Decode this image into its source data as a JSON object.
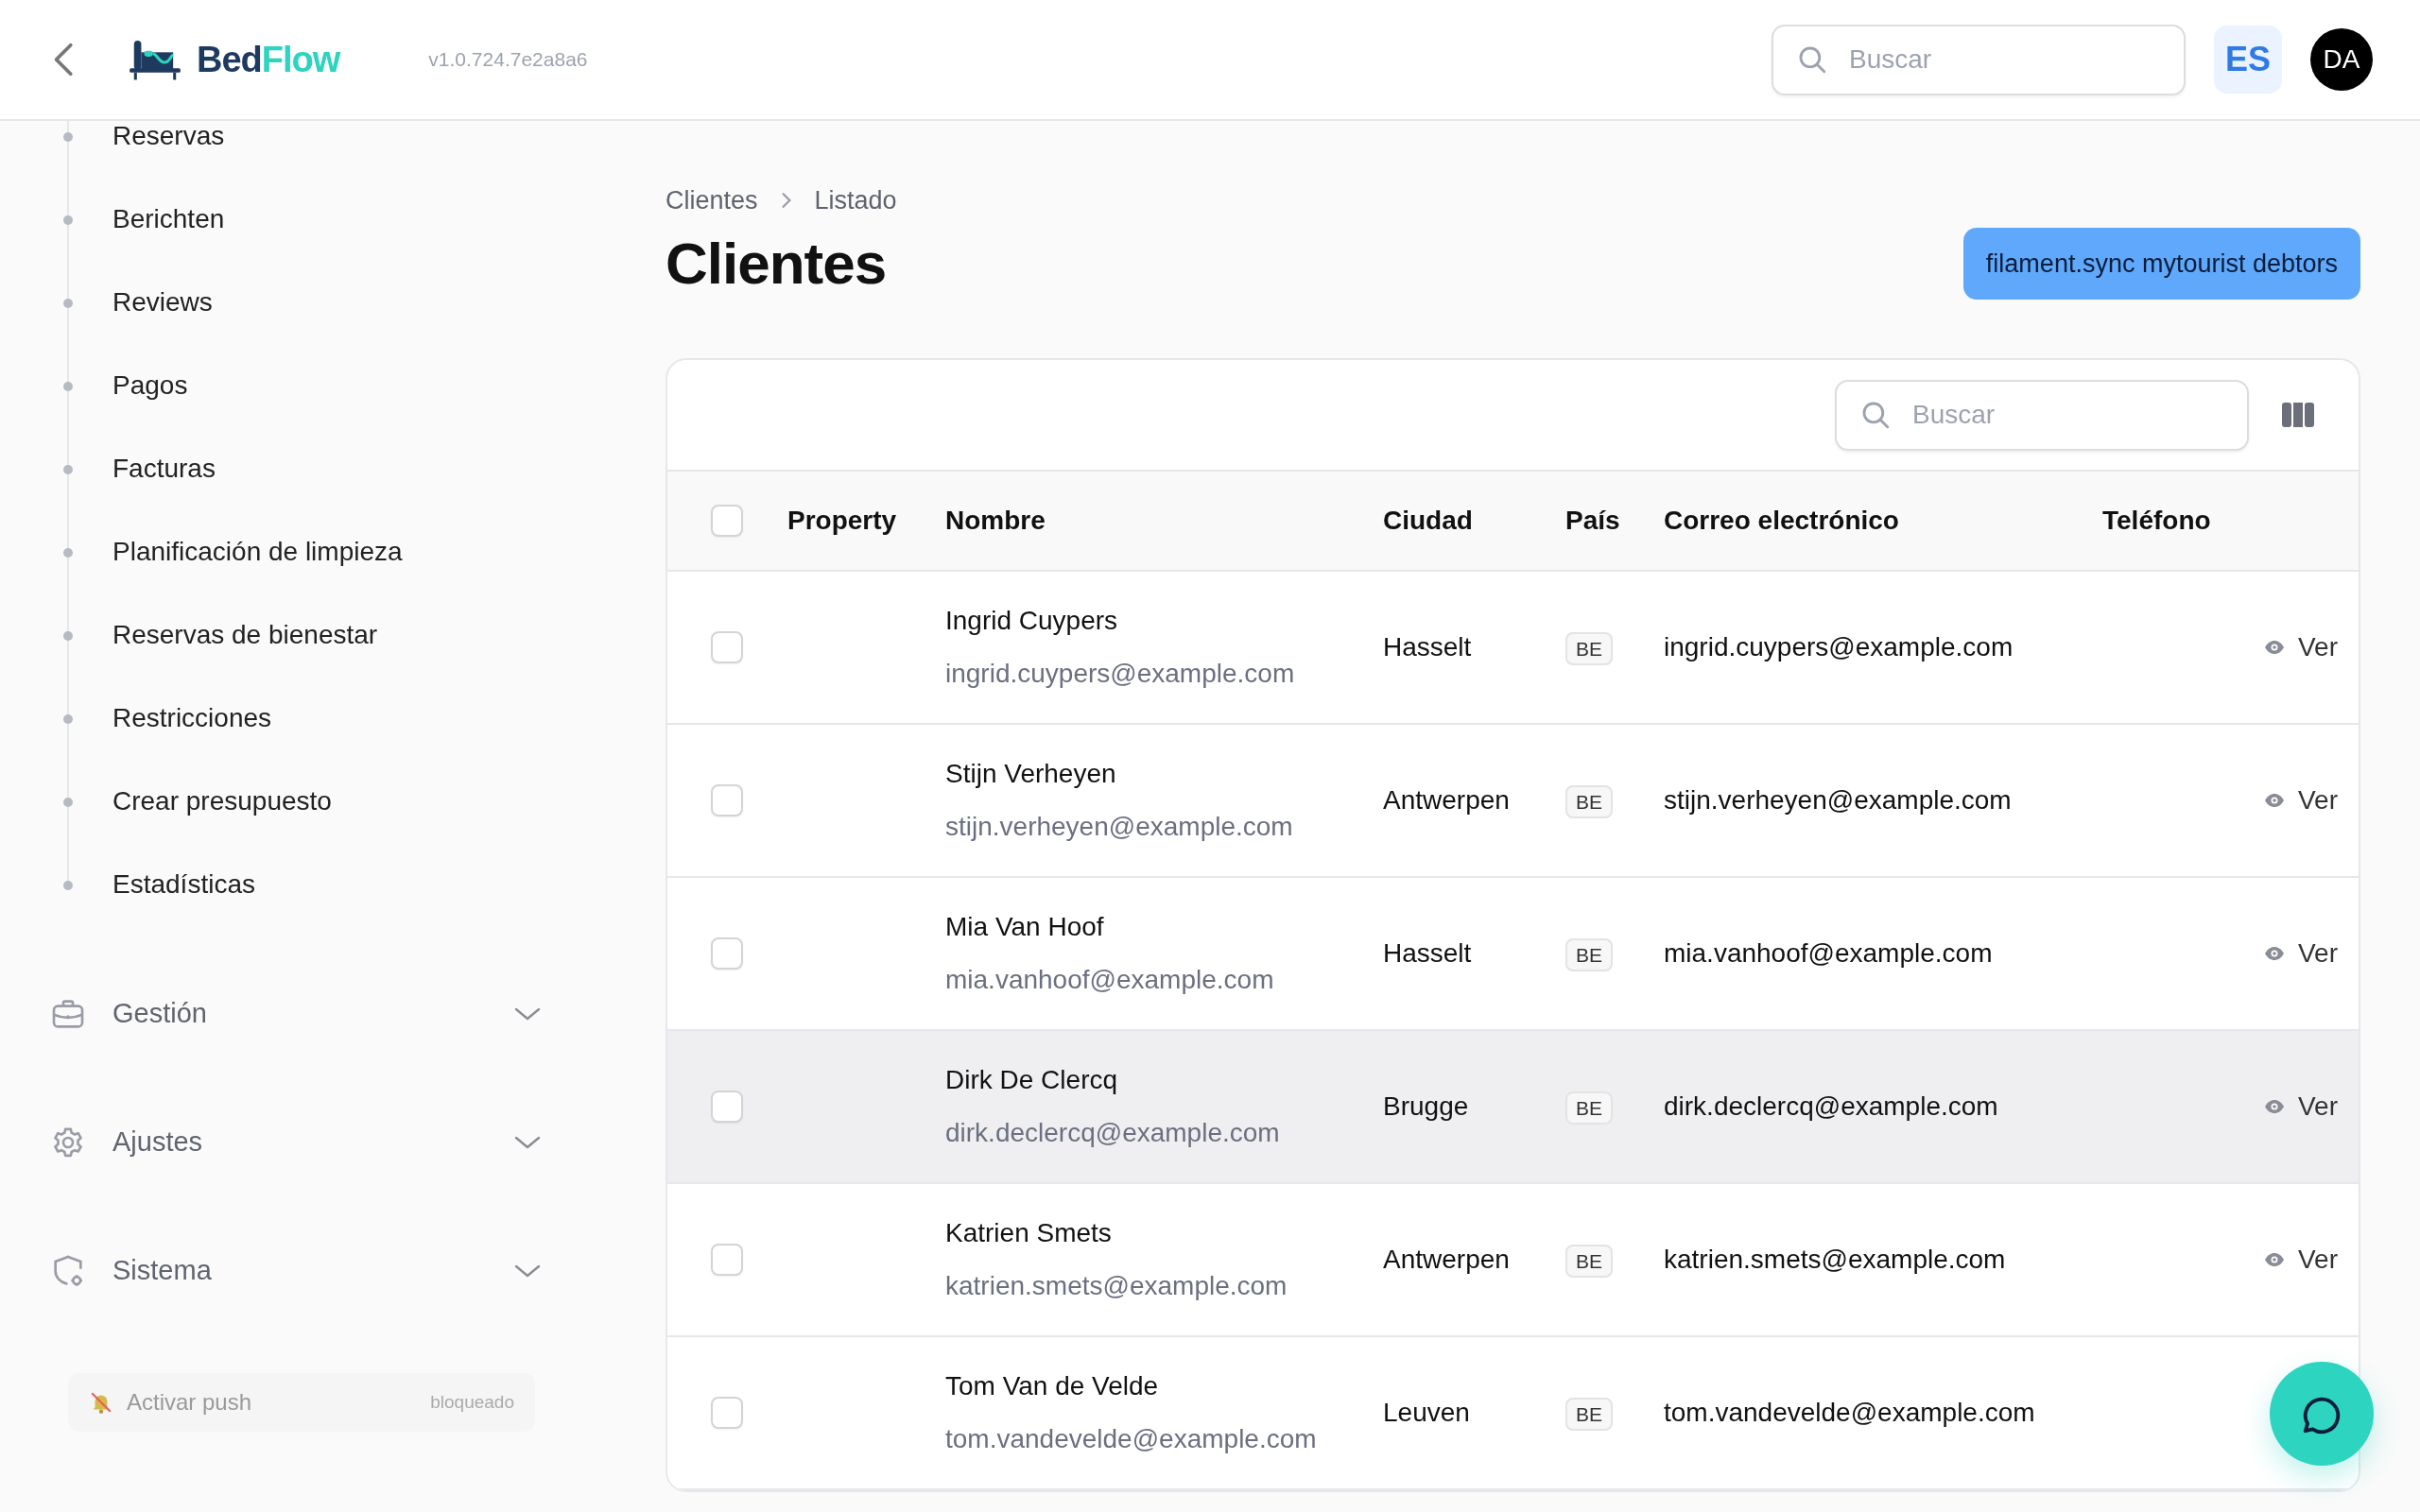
{
  "header": {
    "logo_parts": [
      "Bed",
      "Flow"
    ],
    "version": "v1.0.724.7e2a8a6",
    "search": {
      "placeholder": "Buscar"
    },
    "language": "ES",
    "avatar": "DA"
  },
  "sidebar": {
    "items": [
      "Reservas",
      "Berichten",
      "Reviews",
      "Pagos",
      "Facturas",
      "Planificación de limpieza",
      "Reservas de bienestar",
      "Restricciones",
      "Crear presupuesto",
      "Estadísticas"
    ],
    "groups": [
      {
        "label": "Gestión",
        "kind": "briefcase",
        "expanded": false
      },
      {
        "label": "Ajustes",
        "kind": "gear",
        "expanded": false
      },
      {
        "label": "Sistema",
        "kind": "shield",
        "expanded": false
      }
    ],
    "push": {
      "label": "Activar push",
      "status": "bloqueado"
    }
  },
  "breadcrumbs": [
    "Clientes",
    "Listado"
  ],
  "title": "Clientes",
  "action_button": "filament.sync mytourist debtors",
  "table": {
    "search": {
      "placeholder": "Buscar"
    },
    "select_all": {
      "checked": false
    },
    "columns": [
      "Property",
      "Nombre",
      "Ciudad",
      "País",
      "Correo electrónico",
      "Teléfono"
    ],
    "rows": [
      {
        "name": "Ingrid Cuypers",
        "name_email": "ingrid.cuypers@example.com",
        "city": "Hasselt",
        "country": "BE",
        "email": "ingrid.cuypers@example.com",
        "action": "Ver",
        "selected": false,
        "highlighted": false
      },
      {
        "name": "Stijn Verheyen",
        "name_email": "stijn.verheyen@example.com",
        "city": "Antwerpen",
        "country": "BE",
        "email": "stijn.verheyen@example.com",
        "action": "Ver",
        "selected": false,
        "highlighted": false
      },
      {
        "name": "Mia Van Hoof",
        "name_email": "mia.vanhoof@example.com",
        "city": "Hasselt",
        "country": "BE",
        "email": "mia.vanhoof@example.com",
        "action": "Ver",
        "selected": false,
        "highlighted": false
      },
      {
        "name": "Dirk De Clercq",
        "name_email": "dirk.declercq@example.com",
        "city": "Brugge",
        "country": "BE",
        "email": "dirk.declercq@example.com",
        "action": "Ver",
        "selected": false,
        "highlighted": true
      },
      {
        "name": "Katrien Smets",
        "name_email": "katrien.smets@example.com",
        "city": "Antwerpen",
        "country": "BE",
        "email": "katrien.smets@example.com",
        "action": "Ver",
        "selected": false,
        "highlighted": false
      },
      {
        "name": "Tom Van de Velde",
        "name_email": "tom.vandevelde@example.com",
        "city": "Leuven",
        "country": "BE",
        "email": "tom.vandevelde@example.com",
        "selected": false,
        "highlighted": false
      }
    ]
  }
}
